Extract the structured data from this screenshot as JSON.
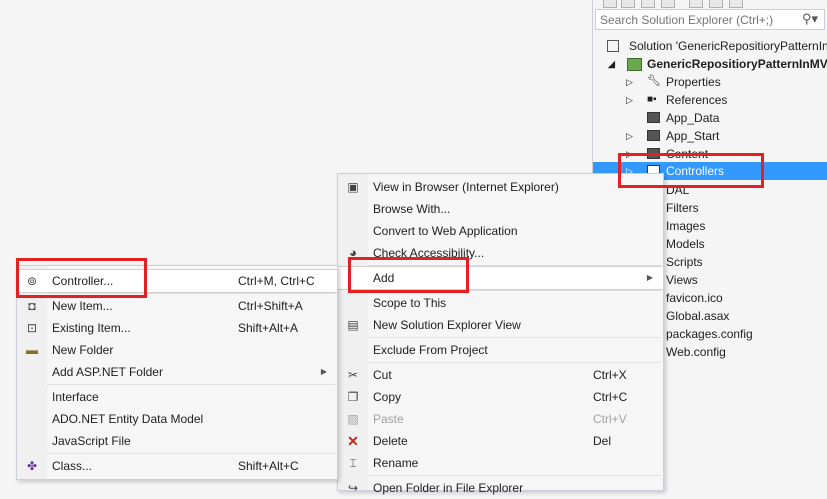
{
  "solution_explorer": {
    "search_placeholder": "Search Solution Explorer (Ctrl+;)",
    "items": [
      {
        "label": "Solution 'GenericRepositioryPatternInMVC'",
        "icon": "solution-icon"
      },
      {
        "label": "GenericRepositioryPatternInMVC",
        "icon": "web-project-icon"
      },
      {
        "label": "Properties",
        "icon": "wrench-icon"
      },
      {
        "label": "References",
        "icon": "references-icon"
      },
      {
        "label": "App_Data",
        "icon": "folder-icon"
      },
      {
        "label": "App_Start",
        "icon": "folder-icon"
      },
      {
        "label": "Content",
        "icon": "folder-icon"
      },
      {
        "label": "Controllers",
        "icon": "folder-icon"
      },
      {
        "label": "DAL",
        "icon": "folder-icon"
      },
      {
        "label": "Filters",
        "icon": "folder-icon"
      },
      {
        "label": "Images",
        "icon": "folder-icon"
      },
      {
        "label": "Models",
        "icon": "folder-icon"
      },
      {
        "label": "Scripts",
        "icon": "folder-icon"
      },
      {
        "label": "Views",
        "icon": "folder-icon"
      },
      {
        "label": "favicon.ico",
        "icon": "file-icon"
      },
      {
        "label": "Global.asax",
        "icon": "file-icon"
      },
      {
        "label": "packages.config",
        "icon": "file-icon"
      },
      {
        "label": "Web.config",
        "icon": "file-icon"
      }
    ]
  },
  "context_menu": {
    "items": [
      {
        "label": "View in Browser (Internet Explorer)",
        "icon": "browser-icon"
      },
      {
        "label": "Browse With...",
        "icon": ""
      },
      {
        "label": "Convert to Web Application",
        "icon": ""
      },
      {
        "label": "Check Accessibility...",
        "icon": "accessibility-icon"
      },
      {
        "label": "Add",
        "icon": ""
      },
      {
        "label": "Scope to This",
        "icon": ""
      },
      {
        "label": "New Solution Explorer View",
        "icon": "new-view-icon"
      },
      {
        "label": "Exclude From Project",
        "icon": ""
      },
      {
        "label": "Cut",
        "icon": "scissors-icon",
        "shortcut": "Ctrl+X"
      },
      {
        "label": "Copy",
        "icon": "copy-icon",
        "shortcut": "Ctrl+C"
      },
      {
        "label": "Paste",
        "icon": "paste-icon",
        "shortcut": "Ctrl+V"
      },
      {
        "label": "Delete",
        "icon": "delete-x-icon",
        "shortcut": "Del"
      },
      {
        "label": "Rename",
        "icon": "rename-icon"
      },
      {
        "label": "Open Folder in File Explorer",
        "icon": "open-folder-icon"
      }
    ]
  },
  "add_submenu": {
    "items": [
      {
        "label": "Controller...",
        "icon": "controller-icon",
        "shortcut": "Ctrl+M, Ctrl+C"
      },
      {
        "label": "New Item...",
        "icon": "new-item-icon",
        "shortcut": "Ctrl+Shift+A"
      },
      {
        "label": "Existing Item...",
        "icon": "existing-item-icon",
        "shortcut": "Shift+Alt+A"
      },
      {
        "label": "New Folder",
        "icon": "new-folder-icon",
        "shortcut": ""
      },
      {
        "label": "Add ASP.NET Folder",
        "icon": "",
        "shortcut": ""
      },
      {
        "label": "Interface",
        "icon": "",
        "shortcut": ""
      },
      {
        "label": "ADO.NET Entity Data Model",
        "icon": "",
        "shortcut": ""
      },
      {
        "label": "JavaScript File",
        "icon": "",
        "shortcut": ""
      },
      {
        "label": "Class...",
        "icon": "class-icon",
        "shortcut": "Shift+Alt+C"
      }
    ]
  },
  "colors": {
    "selection": "#3399ff",
    "highlight_box": "#e32022"
  }
}
